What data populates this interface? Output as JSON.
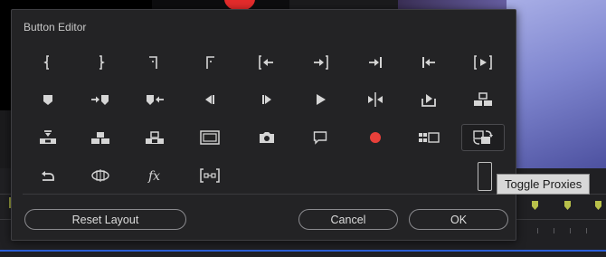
{
  "dialog": {
    "title": "Button Editor",
    "buttons": {
      "reset_layout": "Reset Layout",
      "cancel": "Cancel",
      "ok": "OK"
    }
  },
  "tooltip": {
    "text": "Toggle Proxies"
  },
  "icon_rows": [
    [
      "mark-in-icon",
      "mark-out-icon",
      "mark-clip-icon",
      "go-to-in-icon-alt",
      "go-to-in-icon",
      "go-to-out-icon",
      "go-to-next-edit-icon",
      "go-to-previous-edit-icon",
      "play-in-to-out-icon"
    ],
    [
      "add-marker-icon",
      "go-to-next-marker-icon",
      "go-to-previous-marker-icon",
      "step-back-icon",
      "step-forward-icon",
      "play-icon",
      "trim-edit-icon",
      "export-frame-icon",
      "lift-icon"
    ],
    [
      "extract-icon",
      "insert-icon",
      "overwrite-icon",
      "safe-margins-icon",
      "camera-icon",
      "comment-icon",
      "record-icon",
      "multi-camera-icon",
      "toggle-proxies-icon"
    ],
    [
      "loop-icon",
      "vr-video-icon",
      "fx-icon",
      "trim-bracket-icon"
    ]
  ],
  "colors": {
    "record": "#e8403a",
    "dialog_bg": "#232325",
    "tooltip_bg": "#d8d8d8",
    "timeline_marker": "#b8c04a"
  }
}
